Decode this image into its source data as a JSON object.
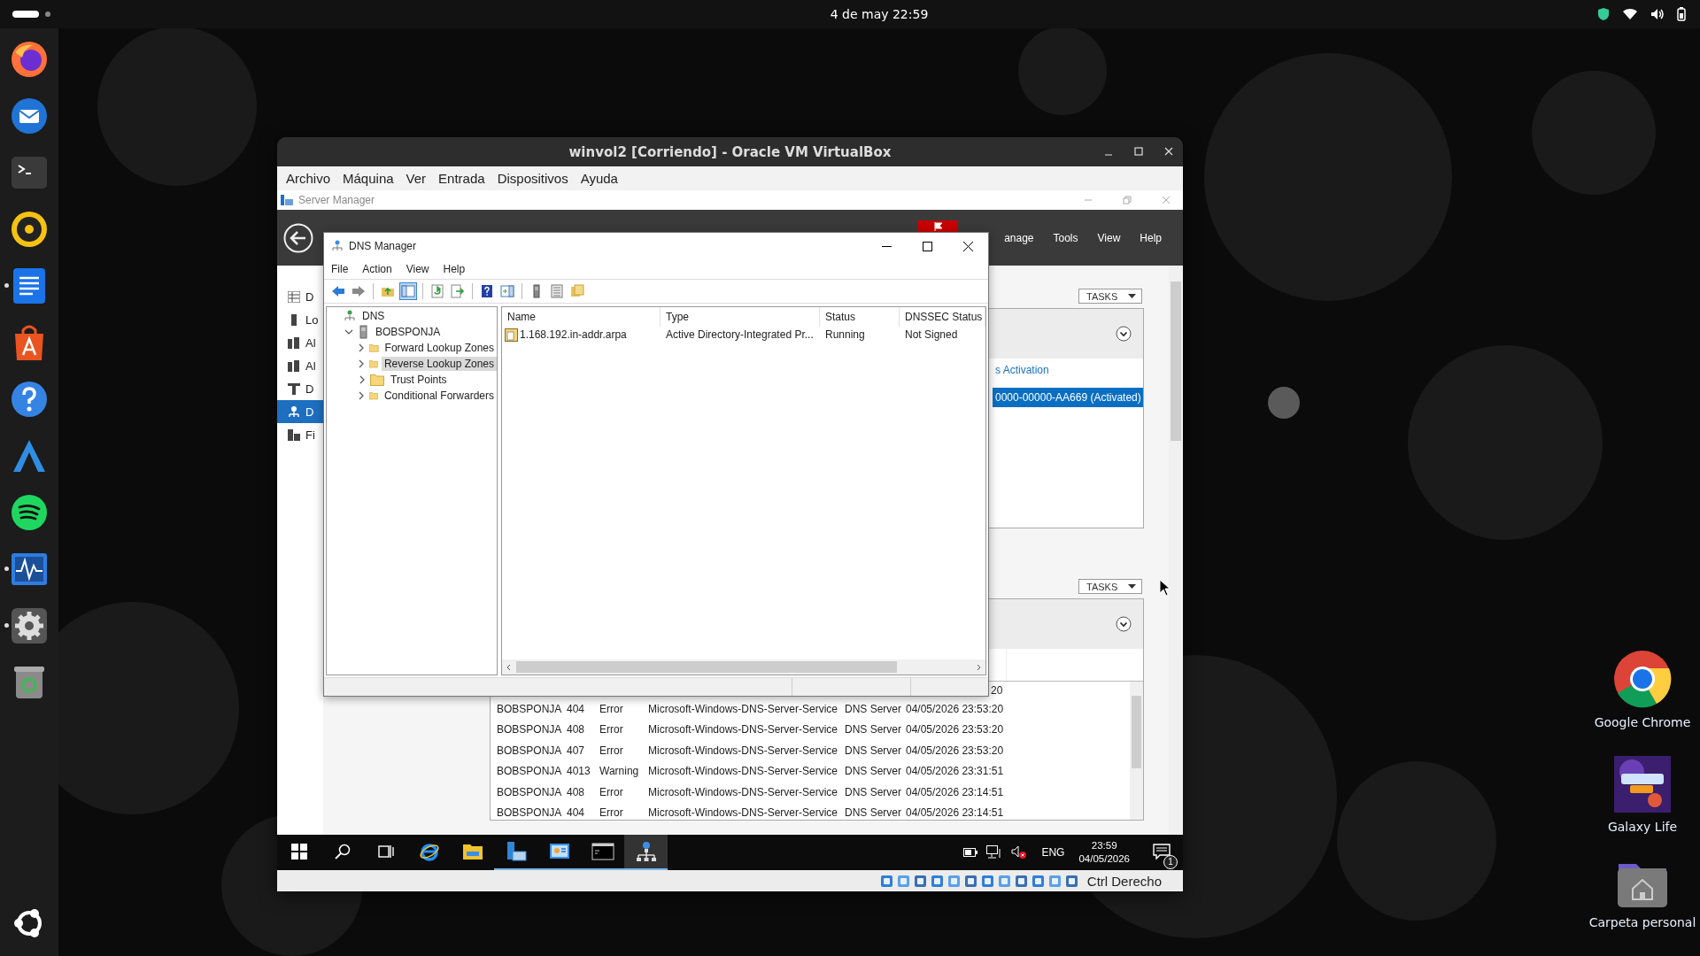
{
  "top_bar": {
    "clock": "4 de may  22:59"
  },
  "dock": [
    {
      "kind": "firefox",
      "running": false
    },
    {
      "kind": "mail",
      "running": false
    },
    {
      "kind": "terminal",
      "running": false
    },
    {
      "kind": "speaker",
      "running": false
    },
    {
      "kind": "writer",
      "running": true
    },
    {
      "kind": "store",
      "running": false
    },
    {
      "kind": "help",
      "running": false
    },
    {
      "kind": "peak",
      "running": false
    },
    {
      "kind": "music",
      "running": false
    },
    {
      "kind": "monitor",
      "running": true
    },
    {
      "kind": "settings",
      "running": true
    },
    {
      "kind": "trash",
      "running": false
    },
    {
      "kind": "apps",
      "running": false
    }
  ],
  "desktop_icons": [
    {
      "kind": "chrome",
      "label": "Google Chrome"
    },
    {
      "kind": "game",
      "label": "Galaxy Life"
    },
    {
      "kind": "home",
      "label": "Carpeta personal"
    }
  ],
  "virtualbox": {
    "title": "winvol2 [Corriendo] - Oracle VM VirtualBox",
    "menu": [
      "Archivo",
      "Máquina",
      "Ver",
      "Entrada",
      "Dispositivos",
      "Ayuda"
    ],
    "status_label": "Ctrl Derecho"
  },
  "server_manager": {
    "title": "Server Manager",
    "menu": [
      "anage",
      "Tools",
      "View",
      "Help"
    ],
    "nav": [
      {
        "kind": "dashboard",
        "label": "D",
        "selected": false
      },
      {
        "kind": "server",
        "label": "Lo",
        "selected": false
      },
      {
        "kind": "servers",
        "label": "Al",
        "selected": false
      },
      {
        "kind": "servers",
        "label": "Al",
        "selected": false
      },
      {
        "kind": "tree",
        "label": "D",
        "selected": false
      },
      {
        "kind": "dns",
        "label": "D",
        "selected": true
      },
      {
        "kind": "files",
        "label": "Fi",
        "selected": false
      }
    ],
    "tasks": [
      "TASKS",
      "TASKS"
    ],
    "panel_rows": [
      {
        "kind": "link",
        "text": "s Activation",
        "selected": false
      },
      {
        "kind": "item",
        "text": "0000-00000-AA669 (Activated)",
        "selected": true
      }
    ],
    "events": {
      "partial_cell": "20",
      "rows": [
        {
          "server": "BOBSPONJA",
          "id": "404",
          "level": "Error",
          "source": "Microsoft-Windows-DNS-Server-Service",
          "log": "DNS Server",
          "date": "04/05/2026 23:53:20"
        },
        {
          "server": "BOBSPONJA",
          "id": "408",
          "level": "Error",
          "source": "Microsoft-Windows-DNS-Server-Service",
          "log": "DNS Server",
          "date": "04/05/2026 23:53:20"
        },
        {
          "server": "BOBSPONJA",
          "id": "407",
          "level": "Error",
          "source": "Microsoft-Windows-DNS-Server-Service",
          "log": "DNS Server",
          "date": "04/05/2026 23:53:20"
        },
        {
          "server": "BOBSPONJA",
          "id": "4013",
          "level": "Warning",
          "source": "Microsoft-Windows-DNS-Server-Service",
          "log": "DNS Server",
          "date": "04/05/2026 23:31:51"
        },
        {
          "server": "BOBSPONJA",
          "id": "408",
          "level": "Error",
          "source": "Microsoft-Windows-DNS-Server-Service",
          "log": "DNS Server",
          "date": "04/05/2026 23:14:51"
        },
        {
          "server": "BOBSPONJA",
          "id": "404",
          "level": "Error",
          "source": "Microsoft-Windows-DNS-Server-Service",
          "log": "DNS Server",
          "date": "04/05/2026 23:14:51"
        }
      ]
    }
  },
  "dns_manager": {
    "title": "DNS Manager",
    "menu": [
      "File",
      "Action",
      "View",
      "Help"
    ],
    "toolbar": [
      {
        "kind": "back",
        "pressed": false
      },
      {
        "kind": "forward",
        "pressed": false
      },
      {
        "kind": "sep"
      },
      {
        "kind": "up",
        "pressed": false
      },
      {
        "kind": "tree",
        "pressed": true
      },
      {
        "kind": "sep"
      },
      {
        "kind": "refresh",
        "pressed": false
      },
      {
        "kind": "export",
        "pressed": false
      },
      {
        "kind": "sep"
      },
      {
        "kind": "help",
        "pressed": false
      },
      {
        "kind": "pane",
        "pressed": false
      },
      {
        "kind": "sep"
      },
      {
        "kind": "server",
        "pressed": false
      },
      {
        "kind": "list",
        "pressed": false
      },
      {
        "kind": "folders",
        "pressed": false
      }
    ],
    "tree": [
      {
        "kind": "dns",
        "label": "DNS",
        "selected": false,
        "children": [
          {
            "kind": "server",
            "label": "BOBSPONJA",
            "selected": false,
            "expanded": true,
            "children": [
              {
                "kind": "folder",
                "label": "Forward Lookup Zones",
                "selected": false,
                "expanded": false
              },
              {
                "kind": "folder",
                "label": "Reverse Lookup Zones",
                "selected": true,
                "expanded": false
              },
              {
                "kind": "folder",
                "label": "Trust Points",
                "selected": false,
                "expanded": false
              },
              {
                "kind": "folder",
                "label": "Conditional Forwarders",
                "selected": false,
                "expanded": false
              }
            ]
          }
        ]
      }
    ],
    "columns": [
      "Name",
      "Type",
      "Status",
      "DNSSEC Status"
    ],
    "rows": [
      {
        "name": "1.168.192.in-addr.arpa",
        "type": "Active Directory-Integrated Pr...",
        "status": "Running",
        "dnssec": "Not Signed"
      }
    ]
  },
  "taskbar": {
    "items": [
      {
        "kind": "start",
        "open": false,
        "selected": false
      },
      {
        "kind": "search",
        "open": false,
        "selected": false
      },
      {
        "kind": "taskview",
        "open": false,
        "selected": false
      },
      {
        "kind": "ie",
        "open": false,
        "selected": false
      },
      {
        "kind": "explorer",
        "open": false,
        "selected": false
      },
      {
        "kind": "servermanager",
        "open": true,
        "selected": false
      },
      {
        "kind": "controlpanel",
        "open": true,
        "selected": false
      },
      {
        "kind": "cmd",
        "open": true,
        "selected": false
      },
      {
        "kind": "dns",
        "open": true,
        "selected": true
      }
    ],
    "language": "ENG",
    "time": "23:59",
    "date": "04/05/2026",
    "notifications": "1"
  }
}
